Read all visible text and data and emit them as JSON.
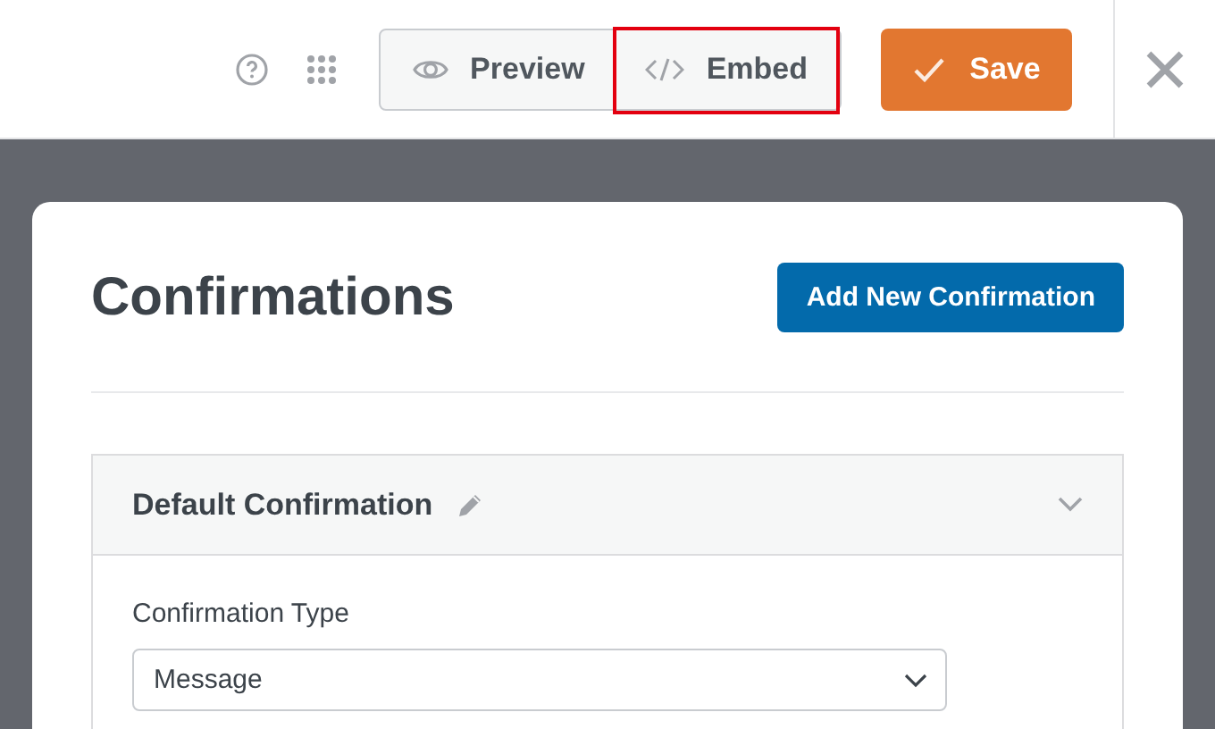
{
  "toolbar": {
    "buttons": [
      {
        "kind": "preview",
        "label": "Preview",
        "highlighted": false
      },
      {
        "kind": "embed",
        "label": "Embed",
        "highlighted": true
      }
    ],
    "save": {
      "label": "Save"
    }
  },
  "card": {
    "title": "Confirmations",
    "add_button": "Add New Confirmation",
    "panel": {
      "title": "Default Confirmation",
      "expanded": true,
      "field_label": "Confirmation Type",
      "select_value": "Message"
    }
  }
}
